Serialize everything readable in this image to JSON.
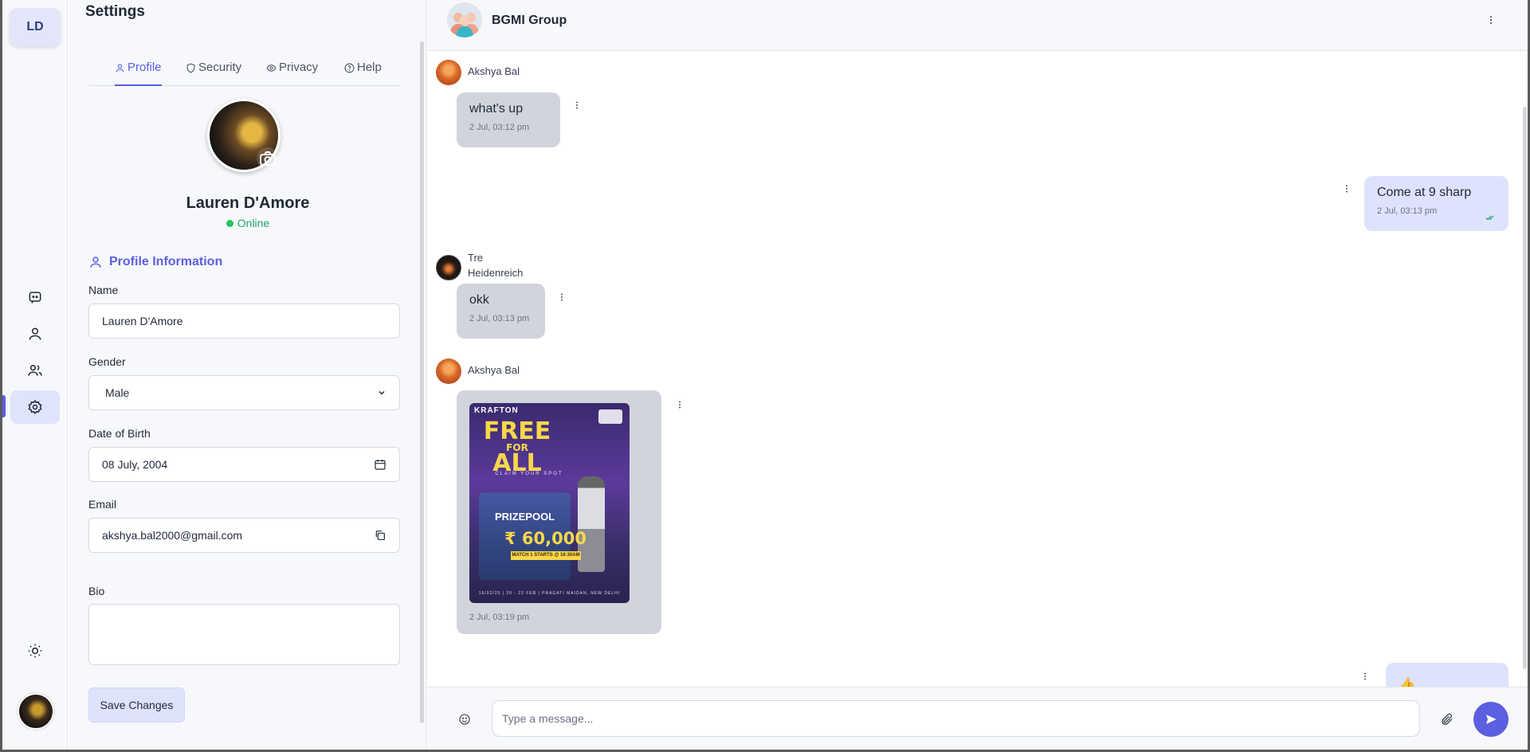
{
  "rail": {
    "logo": "LD",
    "items": [
      {
        "name": "chats",
        "icon": "chat-bubble-icon"
      },
      {
        "name": "profile",
        "icon": "user-icon"
      },
      {
        "name": "groups",
        "icon": "users-icon"
      },
      {
        "name": "settings",
        "icon": "gear-icon",
        "active": true
      }
    ],
    "theme_icon": "sun-icon"
  },
  "settings": {
    "title": "Settings",
    "tabs": [
      {
        "label": "Profile",
        "icon": "user-icon",
        "active": true
      },
      {
        "label": "Security",
        "icon": "shield-icon"
      },
      {
        "label": "Privacy",
        "icon": "eye-icon"
      },
      {
        "label": "Help",
        "icon": "help-circle-icon"
      }
    ],
    "user_name": "Lauren D'Amore",
    "status": "Online",
    "section_title": "Profile Information",
    "fields": {
      "name": {
        "label": "Name",
        "value": "Lauren D'Amore"
      },
      "gender": {
        "label": "Gender",
        "value": "Male"
      },
      "dob": {
        "label": "Date of Birth",
        "value": "08 July, 2004"
      },
      "email": {
        "label": "Email",
        "value": "akshya.bal2000@gmail.com"
      },
      "bio": {
        "label": "Bio",
        "value": ""
      }
    },
    "save_label": "Save Changes"
  },
  "chat": {
    "group_name": "BGMI Group",
    "messages": [
      {
        "sender": "Akshya Bal",
        "text": "what's up",
        "time": "2 Jul, 03:12 pm",
        "direction": "in"
      },
      {
        "sender": "",
        "text": "Come at 9 sharp",
        "time": "2 Jul, 03:13 pm",
        "direction": "out"
      },
      {
        "sender_line1": "Tre",
        "sender_line2": "Heidenreich",
        "text": "okk",
        "time": "2 Jul, 03:13 pm",
        "direction": "in"
      },
      {
        "sender": "Akshya Bal",
        "time": "2 Jul, 03:19 pm",
        "direction": "in",
        "image": {
          "brand": "KRAFTON",
          "headline_line1": "FREE",
          "headline_line2": "FOR",
          "headline_line3": "ALL",
          "tagline": "CLAIM YOUR SPOT",
          "prize_label": "PRIZEPOOL",
          "prize_amount": "₹ 60,000",
          "match_note": "MATCH 1 STARTS @ 10:30AM",
          "footer": "16/02/25 | 20 - 22 FEB | PRAGATI MAIDAN, NEW DELHI"
        }
      },
      {
        "sender": "",
        "text": "👍",
        "direction": "out"
      }
    ],
    "composer_placeholder": "Type a message..."
  }
}
